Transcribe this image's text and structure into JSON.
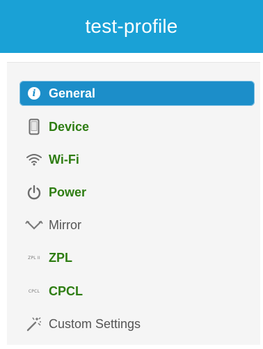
{
  "header": {
    "title": "test-profile"
  },
  "menu": {
    "items": [
      {
        "label": "General",
        "icon": "info-icon",
        "active": true
      },
      {
        "label": "Device",
        "icon": "device-icon"
      },
      {
        "label": "Wi-Fi",
        "icon": "wifi-icon"
      },
      {
        "label": "Power",
        "icon": "power-icon"
      },
      {
        "label": "Mirror",
        "icon": "mirror-icon",
        "disabled": true
      },
      {
        "label": "ZPL",
        "icon": "zpl-icon",
        "icon_text": "ZPL II"
      },
      {
        "label": "CPCL",
        "icon": "cpcl-icon",
        "icon_text": "CPCL"
      },
      {
        "label": "Custom Settings",
        "icon": "magic-wand-icon",
        "disabled": true
      }
    ]
  },
  "colors": {
    "header_bg": "#1aa1d6",
    "active_bg": "#1c8ec9",
    "label_green": "#2e7d12",
    "label_gray": "#555555"
  }
}
